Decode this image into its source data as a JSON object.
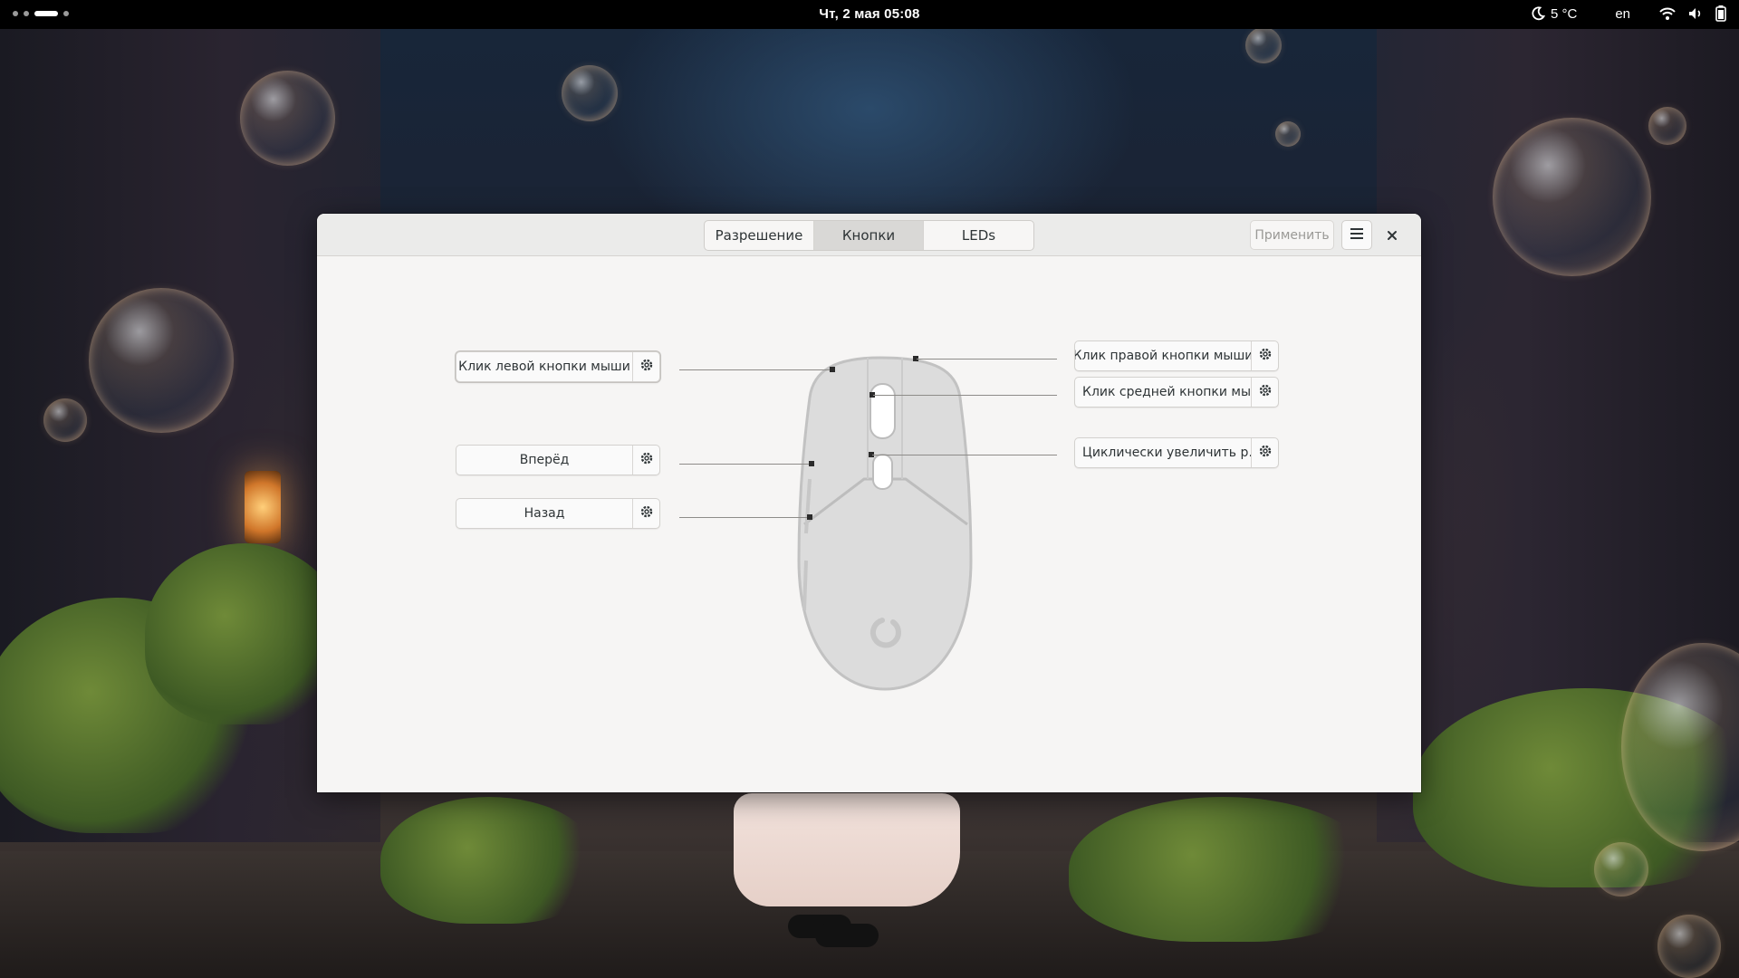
{
  "topbar": {
    "clock": "Чт, 2 мая  05:08",
    "weather": "5 °C",
    "language": "en",
    "icons": [
      "moon-icon",
      "wifi-icon",
      "volume-icon",
      "battery-icon"
    ]
  },
  "window": {
    "tabs": [
      {
        "label": "Разрешение",
        "active": false
      },
      {
        "label": "Кнопки",
        "active": true
      },
      {
        "label": "LEDs",
        "active": false
      }
    ],
    "apply_label": "Применить",
    "menu_icon": "hamburger-menu-icon",
    "close_icon": "close-icon"
  },
  "buttons": {
    "left_click": "Клик левой кнопки мыши",
    "forward": "Вперёд",
    "back": "Назад",
    "right_click": "Клик правой кнопки мыши",
    "middle_click": "Клик средней кнопки мы…",
    "cycle": "Циклически увеличить р…"
  },
  "colors": {
    "window_bg": "#f6f5f4",
    "headerbar_bg": "#ebebea",
    "mouse_body": "#dcdcdc",
    "mouse_outline": "#c2c2c2"
  }
}
